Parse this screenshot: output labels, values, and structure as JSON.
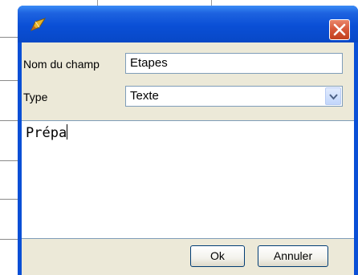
{
  "dialog": {
    "title": "",
    "close_label": "✕"
  },
  "form": {
    "field_name": {
      "label": "Nom du champ",
      "value": "Etapes"
    },
    "type": {
      "label": "Type",
      "value": "Texte",
      "options": [
        "Texte"
      ]
    }
  },
  "editor": {
    "value": "Prépa"
  },
  "buttons": {
    "ok": "Ok",
    "cancel": "Annuler"
  },
  "colors": {
    "titlebar": "#0a4fd6",
    "close_button": "#d85a3c",
    "dialog_face": "#ece9d8",
    "field_border": "#7f9db9"
  },
  "icons": {
    "title": "pencil-icon",
    "close": "close-icon",
    "dropdown": "chevron-down-icon"
  }
}
